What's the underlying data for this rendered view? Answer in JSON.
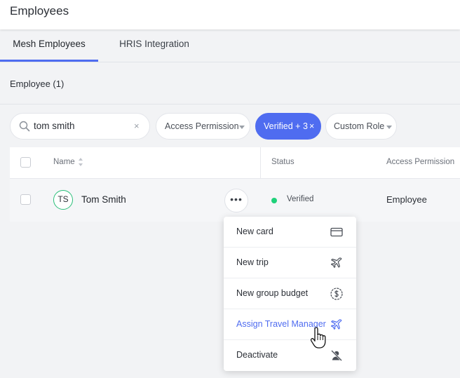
{
  "header": {
    "title": "Employees"
  },
  "tabs": [
    {
      "label": "Mesh Employees",
      "active": true
    },
    {
      "label": "HRIS Integration",
      "active": false
    }
  ],
  "section": {
    "title": "Employee (1)"
  },
  "filters": {
    "search_value": "tom smith",
    "clear_symbol": "×",
    "access_permission": "Access Permission",
    "verified": "Verified + 3",
    "verified_clear": "×",
    "custom_role": "Custom Role"
  },
  "table": {
    "columns": [
      "Name",
      "Status",
      "Access Permission"
    ],
    "rows": [
      {
        "initials": "TS",
        "name": "Tom Smith",
        "more": "•••",
        "status": "Verified",
        "access": "Employee"
      }
    ]
  },
  "menu": {
    "items": [
      {
        "label": "New card",
        "icon": "card-icon"
      },
      {
        "label": "New trip",
        "icon": "plane-icon"
      },
      {
        "label": "New group budget",
        "icon": "dollar-circle-icon"
      },
      {
        "label": "Assign Travel Manager",
        "icon": "plane-icon",
        "highlighted": true
      },
      {
        "label": "Deactivate",
        "icon": "user-off-icon"
      }
    ]
  },
  "colors": {
    "accent": "#4f6cf0",
    "verified_dot": "#1fd17a",
    "avatar_ring": "#2bbf7a"
  }
}
